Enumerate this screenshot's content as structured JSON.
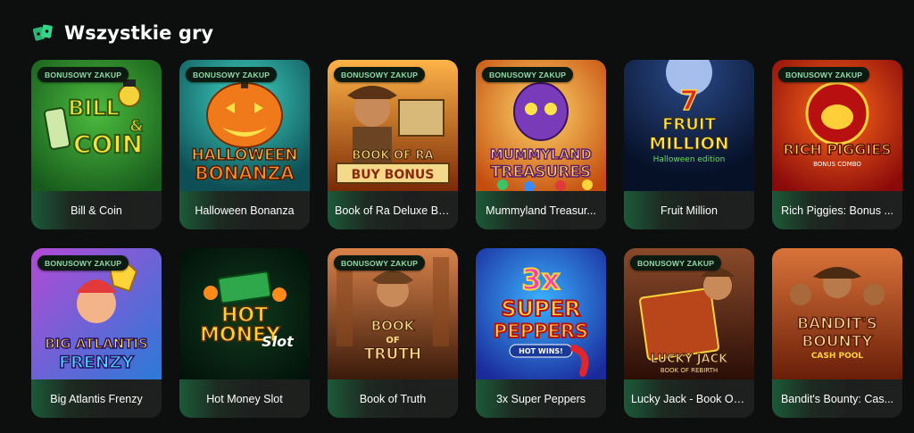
{
  "section": {
    "title": "Wszystkie gry",
    "icon": "cards-icon"
  },
  "badge_label": "BONUSOWY ZAKUP",
  "accent_color": "#2bb673",
  "games": [
    {
      "name": "Bill & Coin",
      "bonus": true,
      "art_title": [
        "BILL",
        "&",
        "COIN"
      ]
    },
    {
      "name": "Halloween Bonanza",
      "bonus": true,
      "art_title": [
        "HALLOWEEN",
        "BONANZA"
      ]
    },
    {
      "name": "Book of Ra Deluxe Bu...",
      "bonus": true,
      "art_title": [
        "BOOK OF RA",
        "BUY BONUS"
      ]
    },
    {
      "name": "Mummyland Treasur...",
      "bonus": true,
      "art_title": [
        "MUMMYLAND",
        "TREASURES"
      ]
    },
    {
      "name": "Fruit Million",
      "bonus": false,
      "art_title": [
        "FRUIT",
        "MILLION",
        "Halloween edition"
      ]
    },
    {
      "name": "Rich Piggies: Bonus ...",
      "bonus": true,
      "art_title": [
        "RICH PIGGIES",
        "BONUS COMBO"
      ]
    },
    {
      "name": "Big Atlantis Frenzy",
      "bonus": true,
      "art_title": [
        "BIG ATLANTIS",
        "FRENZY"
      ]
    },
    {
      "name": "Hot Money Slot",
      "bonus": false,
      "art_title": [
        "HOT",
        "MONEY",
        "Slot"
      ]
    },
    {
      "name": "Book of Truth",
      "bonus": true,
      "art_title": [
        "BOOK",
        "OF",
        "TRUTH"
      ]
    },
    {
      "name": "3x Super Peppers",
      "bonus": false,
      "art_title": [
        "3x",
        "SUPER",
        "PEPPERS",
        "HOT WINS!"
      ]
    },
    {
      "name": "Lucky Jack - Book Of ...",
      "bonus": true,
      "art_title": [
        "LUCKY JACK",
        "BOOK OF REBIRTH"
      ]
    },
    {
      "name": "Bandit's Bounty: Cas...",
      "bonus": false,
      "art_title": [
        "BANDIT'S",
        "BOUNTY",
        "CASH POOL"
      ]
    }
  ]
}
